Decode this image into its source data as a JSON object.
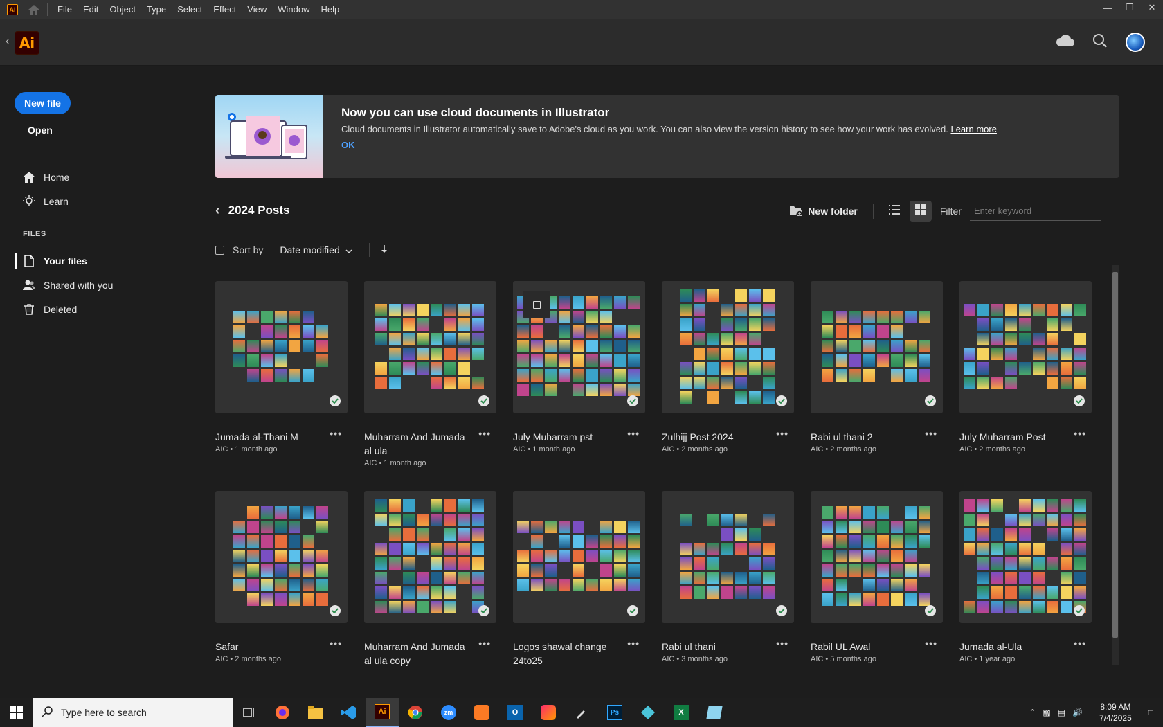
{
  "menubar": {
    "app_icon": "Ai",
    "items": [
      "File",
      "Edit",
      "Object",
      "Type",
      "Select",
      "Effect",
      "View",
      "Window",
      "Help"
    ]
  },
  "header": {
    "logo": "Ai"
  },
  "sidebar": {
    "new_file": "New file",
    "open": "Open",
    "home": "Home",
    "learn": "Learn",
    "files_heading": "FILES",
    "your_files": "Your files",
    "shared": "Shared with you",
    "deleted": "Deleted"
  },
  "banner": {
    "title": "Now you can use cloud documents in Illustrator",
    "body": "Cloud documents in Illustrator automatically save to Adobe's cloud as you work. You can also view the version history to see how your work has evolved.",
    "learn_more": "Learn more",
    "ok": "OK"
  },
  "toolbar": {
    "folder_title": "2024 Posts",
    "new_folder": "New folder",
    "filter_label": "Filter",
    "filter_placeholder": "Enter keyword"
  },
  "sort": {
    "label": "Sort by",
    "value": "Date modified"
  },
  "files": [
    {
      "name": "Jumada al-Thani M",
      "meta": "AIC • 1 month ago"
    },
    {
      "name": "Muharram And Jumada al ula",
      "meta": "AIC • 1 month ago"
    },
    {
      "name": "July Muharram pst",
      "meta": "AIC • 1 month ago"
    },
    {
      "name": "Zulhijj Post 2024",
      "meta": "AIC • 2 months ago"
    },
    {
      "name": "Rabi ul thani 2",
      "meta": "AIC • 2 months ago"
    },
    {
      "name": "July Muharram Post",
      "meta": "AIC • 2 months ago"
    },
    {
      "name": "Safar",
      "meta": "AIC • 2 months ago"
    },
    {
      "name": "Muharram And Jumada al ula copy",
      "meta": ""
    },
    {
      "name": "Logos shawal change 24to25",
      "meta": ""
    },
    {
      "name": "Rabi ul thani",
      "meta": "AIC • 3 months ago"
    },
    {
      "name": "Rabil UL Awal",
      "meta": "AIC • 5 months ago"
    },
    {
      "name": "Jumada al-Ula",
      "meta": "AIC • 1 year ago"
    }
  ],
  "taskbar": {
    "search_placeholder": "Type here to search",
    "time": "8:09 AM",
    "date": "7/4/2025"
  },
  "colors": {
    "accent": "#1473e6",
    "ai_orange": "#ff9a00",
    "ai_bg": "#330000"
  }
}
